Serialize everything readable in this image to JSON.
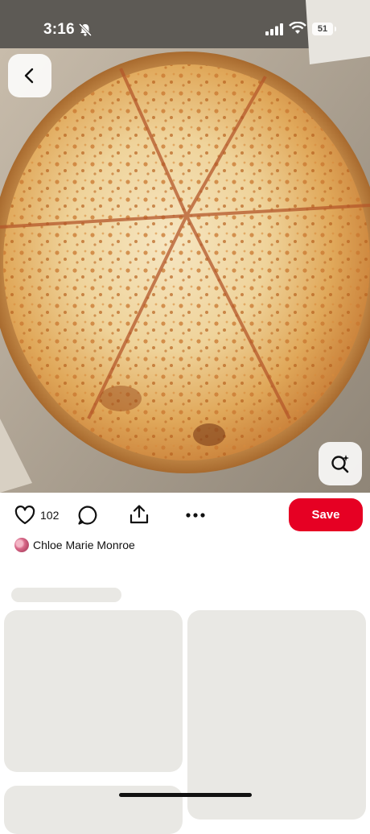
{
  "status_bar": {
    "time": "3:16",
    "battery": "51",
    "icons": [
      "bell-slash-icon",
      "cellular-signal-icon",
      "wifi-icon",
      "battery-icon"
    ]
  },
  "hero": {
    "image": "pizza-photo",
    "back_icon": "chevron-left-icon",
    "visual_search_icon": "visual-search-icon"
  },
  "actions": {
    "like_icon": "heart-icon",
    "like_count": "102",
    "comment_icon": "comment-icon",
    "share_icon": "share-icon",
    "more_icon": "more-icon",
    "save_label": "Save"
  },
  "author": {
    "name": "Chloe Marie Monroe"
  },
  "colors": {
    "save_button": "#e60023",
    "skeleton": "#e9e8e4",
    "background": "#ffffff"
  }
}
